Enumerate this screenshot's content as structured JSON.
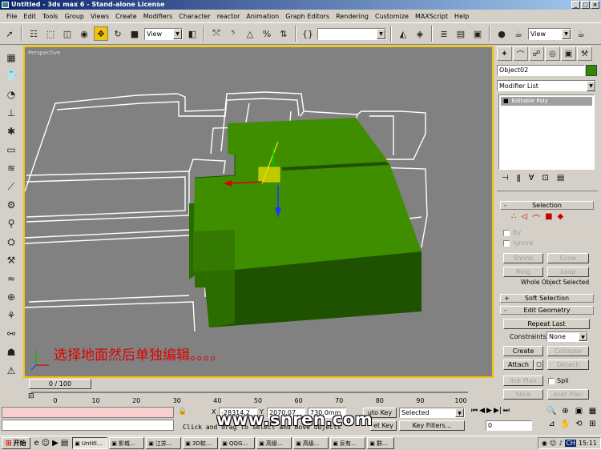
{
  "window": {
    "title": "Untitled - 3ds max 6 - Stand-alone License"
  },
  "menu": [
    "File",
    "Edit",
    "Tools",
    "Group",
    "Views",
    "Create",
    "Modifiers",
    "Character",
    "reactor",
    "Animation",
    "Graph Editors",
    "Rendering",
    "Customize",
    "MAXScript",
    "Help"
  ],
  "toolbar": {
    "ref_coord": "View",
    "ref_coord2": "View",
    "named_sel": ""
  },
  "viewport": {
    "label": "Perspective",
    "annotation": "选择地面然后单独编辑。。。。"
  },
  "command_panel": {
    "object_name": "Object02",
    "object_color": "#2e8b00",
    "modifier_list": "Modifier List",
    "stack_item": "Editable Poly",
    "selection": {
      "title": "Selection",
      "by": "By",
      "ignore": "Ignore",
      "shrink": "Shrink",
      "grow": "Grow",
      "ring": "Ring",
      "loop": "Loop",
      "status": "Whole Object Selected"
    },
    "soft_selection": "Soft Selection",
    "edit_geometry": {
      "title": "Edit Geometry",
      "repeat_last": "Repeat Last",
      "constraints_label": "Constraints:",
      "constraints_value": "None",
      "create": "Create",
      "collapse": "Collapse",
      "attach": "Attach",
      "detach": "Detach",
      "slice_plane": "lice Plan",
      "split": "Spli",
      "slice": "Slice",
      "reset_plane": "eset Plan"
    }
  },
  "timeline": {
    "slider": "0 / 100"
  },
  "ruler_ticks": [
    "0",
    "10",
    "20",
    "30",
    "40",
    "50",
    "60",
    "70",
    "80",
    "90",
    "100"
  ],
  "status": {
    "prompt": "Click and drag to select and move objects",
    "x_label": "X",
    "x_value": "-28314.2",
    "y_label": "Y",
    "y_value": "2070.07",
    "z_value": "730.0mm",
    "auto_key": "uto Key",
    "selected": "Selected",
    "set_key": "et Key",
    "key_filters": "Key Filters...",
    "frame": "0"
  },
  "watermark": "www.snren.com",
  "taskbar": {
    "start": "开始",
    "tasks": [
      "Untitl...",
      "影城...",
      "江苏...",
      "3D软...",
      "QQG...",
      "高级...",
      "高级...",
      "反有...",
      "群..."
    ],
    "time": "15:11",
    "lang": "CH"
  },
  "colors": {
    "accent": "#f5c400",
    "floor_green": "#3e8e00",
    "wall_dark": "#1f5200"
  }
}
